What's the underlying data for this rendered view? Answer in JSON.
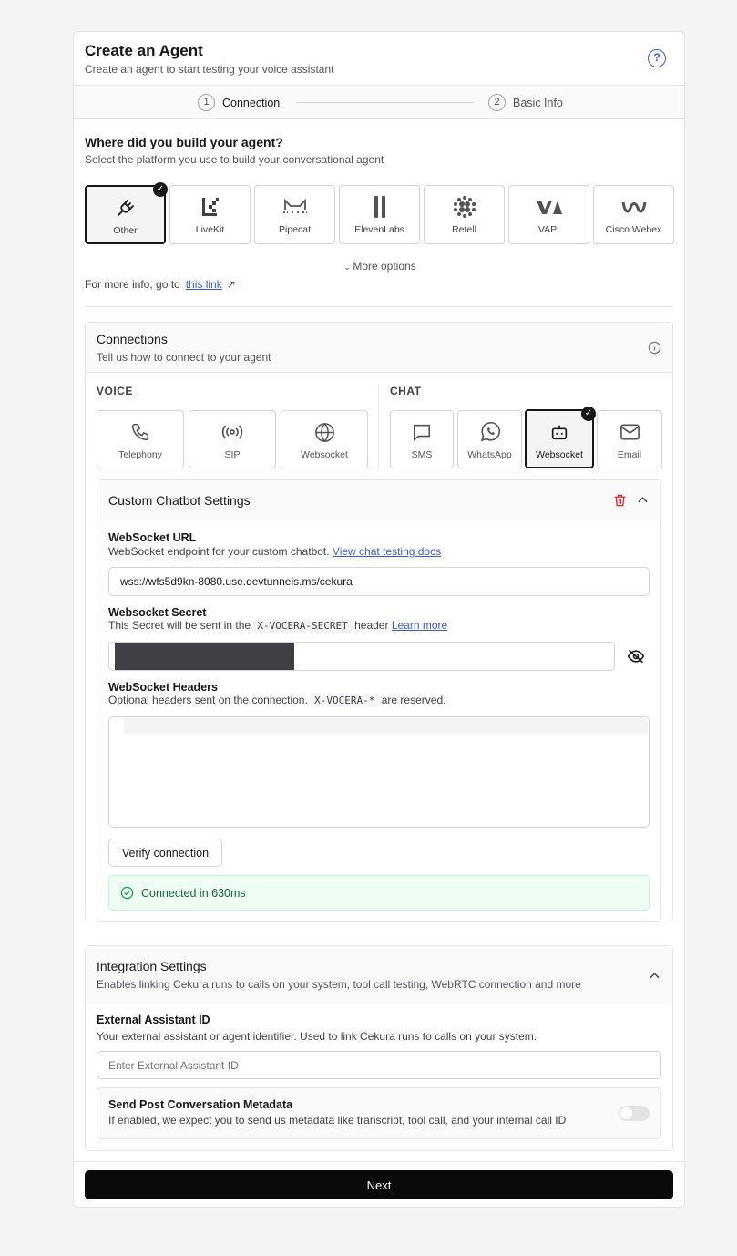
{
  "header": {
    "title": "Create an Agent",
    "subtitle": "Create an agent to start testing your voice assistant"
  },
  "steps": [
    {
      "num": "1",
      "label": "Connection"
    },
    {
      "num": "2",
      "label": "Basic Info"
    }
  ],
  "platform": {
    "title": "Where did you build your agent?",
    "subtitle": "Select the platform you use to build your conversational agent",
    "options": [
      {
        "label": "Other",
        "icon": "plug-icon"
      },
      {
        "label": "LiveKit",
        "icon": "livekit-logo-icon"
      },
      {
        "label": "Pipecat",
        "icon": "pipecat-logo-icon"
      },
      {
        "label": "ElevenLabs",
        "icon": "elevenlabs-logo-icon"
      },
      {
        "label": "Retell",
        "icon": "retell-logo-icon"
      },
      {
        "label": "VAPI",
        "icon": "vapi-logo-icon"
      },
      {
        "label": "Cisco Webex",
        "icon": "webex-logo-icon"
      }
    ],
    "selected": "Other",
    "more_options": "More options",
    "info_text": "For more info, go to",
    "info_link": "this link"
  },
  "connections": {
    "title": "Connections",
    "subtitle": "Tell us how to connect to your agent",
    "voice_label": "VOICE",
    "chat_label": "CHAT",
    "voice": [
      {
        "label": "Telephony",
        "icon": "phone-icon"
      },
      {
        "label": "SIP",
        "icon": "broadcast-icon"
      },
      {
        "label": "Websocket",
        "icon": "globe-icon"
      }
    ],
    "chat": [
      {
        "label": "SMS",
        "icon": "message-icon"
      },
      {
        "label": "WhatsApp",
        "icon": "whatsapp-icon"
      },
      {
        "label": "Websocket",
        "icon": "bot-icon"
      },
      {
        "label": "Email",
        "icon": "mail-icon"
      }
    ],
    "selected_chat": "Websocket"
  },
  "chatbot": {
    "title": "Custom Chatbot Settings",
    "url_label": "WebSocket URL",
    "url_desc": "WebSocket endpoint for your custom chatbot.",
    "url_link": "View chat testing docs",
    "url_value": "wss://wfs5d9kn-8080.use.devtunnels.ms/cekura",
    "secret_label": "Websocket Secret",
    "secret_desc_pre": "This Secret will be sent in the",
    "secret_header": "X-VOCERA-SECRET",
    "secret_desc_post": "header",
    "secret_link": "Learn more",
    "headers_label": "WebSocket Headers",
    "headers_desc_pre": "Optional headers sent on the connection.",
    "headers_code": "X-VOCERA-*",
    "headers_desc_post": "are reserved.",
    "verify_button": "Verify connection",
    "status": "Connected in 630ms"
  },
  "integration": {
    "title": "Integration Settings",
    "subtitle": "Enables linking Cekura runs to calls on your system, tool call testing, WebRTC connection and more",
    "ext_label": "External Assistant ID",
    "ext_desc": "Your external assistant or agent identifier. Used to link Cekura runs to calls on your system.",
    "ext_placeholder": "Enter External Assistant ID",
    "meta_label": "Send Post Conversation Metadata",
    "meta_desc": "If enabled, we expect you to send us metadata like transcript, tool call, and your internal call ID"
  },
  "next_button": "Next",
  "colors": {
    "accent": "#3b5bdb",
    "success_bg": "#f0fdf4",
    "danger": "#dc2626"
  }
}
